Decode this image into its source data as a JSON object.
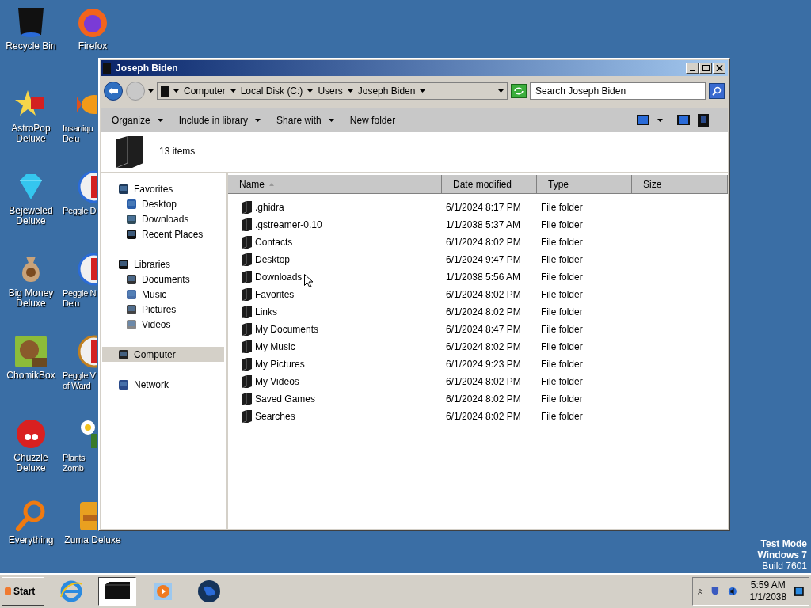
{
  "desktop_icons": [
    {
      "label": "Recycle Bin"
    },
    {
      "label": "AstroPop\nDeluxe"
    },
    {
      "label": "Bejeweled\nDeluxe"
    },
    {
      "label": "Big Money\nDeluxe"
    },
    {
      "label": "ChomikBox"
    },
    {
      "label": "Chuzzle Deluxe"
    },
    {
      "label": "Everything"
    },
    {
      "label": "Firefox"
    },
    {
      "label": "Insaniqu\nDelu"
    },
    {
      "label": "Peggle D"
    },
    {
      "label": "Peggle N\nDelu"
    },
    {
      "label": "Peggle V\nof Ward"
    },
    {
      "label": "Plants\nZomb"
    },
    {
      "label": "Zuma Deluxe"
    }
  ],
  "window": {
    "title": "Joseph Biden",
    "breadcrumbs": [
      "Computer",
      "Local Disk (C:)",
      "Users",
      "Joseph Biden"
    ],
    "search": {
      "placeholder": "Search Joseph Biden"
    },
    "toolbar": [
      {
        "label": "Organize",
        "dropdown": true
      },
      {
        "label": "Include in library",
        "dropdown": true
      },
      {
        "label": "Share with",
        "dropdown": true
      },
      {
        "label": "New folder",
        "dropdown": false
      }
    ],
    "details": {
      "count": "13 items"
    },
    "nav": [
      {
        "label": "Favorites",
        "selected": false,
        "children": [
          {
            "label": "Desktop",
            "selected": false
          },
          {
            "label": "Downloads",
            "selected": false
          },
          {
            "label": "Recent Places",
            "selected": false
          }
        ]
      },
      {
        "label": "Libraries",
        "selected": false,
        "children": [
          {
            "label": "Documents",
            "selected": false
          },
          {
            "label": "Music",
            "selected": false
          },
          {
            "label": "Pictures",
            "selected": false
          },
          {
            "label": "Videos",
            "selected": false
          }
        ]
      },
      {
        "label": "Computer",
        "selected": true
      },
      {
        "label": "Network",
        "selected": false
      }
    ],
    "columns": [
      {
        "label": "Name",
        "sorted": true
      },
      {
        "label": "Date modified",
        "sorted": false
      },
      {
        "label": "Type",
        "sorted": false
      },
      {
        "label": "Size",
        "sorted": false
      }
    ],
    "rows": [
      {
        "name": ".ghidra",
        "date": "6/1/2024 8:17 PM",
        "type": "File folder",
        "selected": false
      },
      {
        "name": ".gstreamer-0.10",
        "date": "1/1/2038 5:37 AM",
        "type": "File folder",
        "selected": false
      },
      {
        "name": "Contacts",
        "date": "6/1/2024 8:02 PM",
        "type": "File folder",
        "selected": false
      },
      {
        "name": "Desktop",
        "date": "6/1/2024 9:47 PM",
        "type": "File folder",
        "selected": false
      },
      {
        "name": "Downloads",
        "date": "1/1/2038 5:56 AM",
        "type": "File folder",
        "selected": false
      },
      {
        "name": "Favorites",
        "date": "6/1/2024 8:02 PM",
        "type": "File folder",
        "selected": false
      },
      {
        "name": "Links",
        "date": "6/1/2024 8:02 PM",
        "type": "File folder",
        "selected": false
      },
      {
        "name": "My Documents",
        "date": "6/1/2024 8:47 PM",
        "type": "File folder",
        "selected": false
      },
      {
        "name": "My Music",
        "date": "6/1/2024 8:02 PM",
        "type": "File folder",
        "selected": false
      },
      {
        "name": "My Pictures",
        "date": "6/1/2024 9:23 PM",
        "type": "File folder",
        "selected": false
      },
      {
        "name": "My Videos",
        "date": "6/1/2024 8:02 PM",
        "type": "File folder",
        "selected": false
      },
      {
        "name": "Saved Games",
        "date": "6/1/2024 8:02 PM",
        "type": "File folder",
        "selected": false
      },
      {
        "name": "Searches",
        "date": "6/1/2024 8:02 PM",
        "type": "File folder",
        "selected": false
      }
    ]
  },
  "os_notice": [
    "Test Mode",
    "Windows 7",
    "Build 7601"
  ],
  "taskbar": {
    "start": "Start",
    "apps": [
      {
        "selected": false
      },
      {
        "selected": true
      },
      {
        "selected": false
      },
      {
        "selected": false
      }
    ],
    "time": "5:59 AM",
    "date": "1/1/2038"
  }
}
